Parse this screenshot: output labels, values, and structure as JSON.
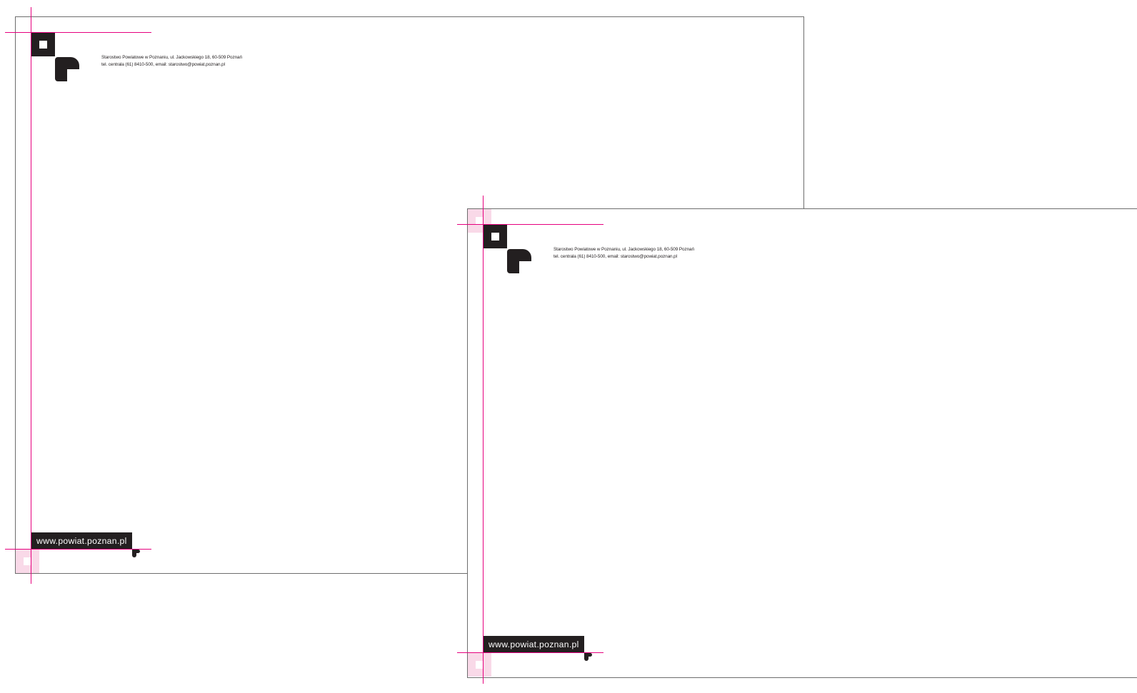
{
  "letterheads": [
    {
      "address_line_1": "Starostwo Powiatowe w Poznaniu, ul. Jackowskiego 18, 60-509 Poznań",
      "address_line_2": "tel. centrala (61) 8410-500, email: starostwo@powiat.poznan.pl",
      "website": "www.powiat.poznan.pl",
      "logo_icon": "powiat-poznanski-logo-icon"
    },
    {
      "address_line_1": "Starostwo Powiatowe w Poznaniu, ul. Jackowskiego 18, 60-509 Poznań",
      "address_line_2": "tel. centrala (61) 8410-500, email: starostwo@powiat.poznan.pl",
      "website": "www.powiat.poznan.pl",
      "logo_icon": "powiat-poznanski-logo-icon"
    }
  ],
  "colors": {
    "guide": "#e6007e",
    "guide_fill": "#f9d9e8",
    "logo": "#231f20",
    "sheet_border": "#6d6d6d"
  }
}
